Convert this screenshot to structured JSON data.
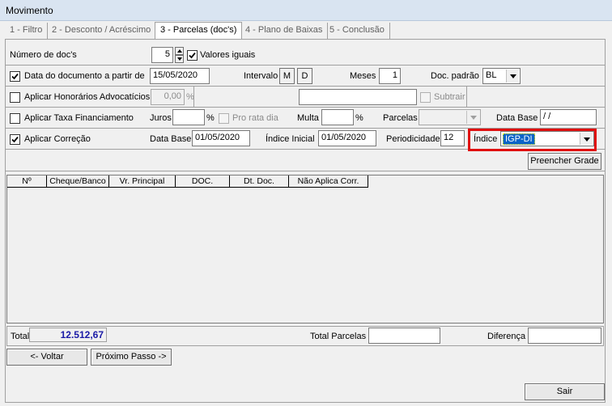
{
  "window": {
    "title": "Movimento"
  },
  "tabs": [
    {
      "label": "1 - Filtro"
    },
    {
      "label": "2 - Desconto / Acréscimo"
    },
    {
      "label": "3 - Parcelas (doc's)"
    },
    {
      "label": "4 - Plano de Baixas"
    },
    {
      "label": "5 - Conclusão"
    }
  ],
  "form": {
    "num_docs_label": "Número de doc's",
    "num_docs_value": "5",
    "valores_iguais_label": "Valores iguais",
    "data_doc_label": "Data do documento a partir de",
    "data_doc_value": "15/05/2020",
    "intervalo_label": "Intervalo",
    "intervalo_m": "M",
    "intervalo_d": "D",
    "meses_label": "Meses",
    "meses_value": "1",
    "doc_padrao_label": "Doc. padrão",
    "doc_padrao_value": "BL",
    "honorarios_label": "Aplicar Honorários Advocatícios",
    "honorarios_value": "0,00",
    "percent_symbol": "%",
    "honorarios_text_value": "",
    "subtrair_label": "Subtrair",
    "taxa_label": "Aplicar Taxa Financiamento",
    "juros_label": "Juros",
    "juros_value": "",
    "pro_rata_label": "Pro rata dia",
    "multa_label": "Multa",
    "multa_value": "",
    "parcelas_label": "Parcelas",
    "parcelas_value": "",
    "data_base_label": "Data Base",
    "data_base_taxa_value": " / /",
    "correcao_label": "Aplicar Correção",
    "data_base_corr_value": "01/05/2020",
    "indice_inicial_label": "Índice Inicial",
    "indice_inicial_value": "01/05/2020",
    "periodicidade_label": "Periodicidade",
    "periodicidade_value": "12",
    "indice_label": "Índice",
    "indice_value": "IGP-DI",
    "preencher_grade_label": "Preencher Grade"
  },
  "grid": {
    "columns": [
      "Nº",
      "Cheque/Banco",
      "Vr. Principal",
      "DOC.",
      "Dt. Doc.",
      "Não Aplica Corr."
    ]
  },
  "totals": {
    "total_label": "Total",
    "total_value": "12.512,67",
    "total_parcelas_label": "Total Parcelas",
    "total_parcelas_value": "",
    "diferenca_label": "Diferença",
    "diferenca_value": ""
  },
  "nav": {
    "voltar_label": "<- Voltar",
    "proximo_label": "Próximo Passo ->",
    "sair_label": "Sair"
  },
  "colors": {
    "highlight": "#e01010",
    "selection": "#0a64c8",
    "total_text": "#1a1aa6"
  }
}
